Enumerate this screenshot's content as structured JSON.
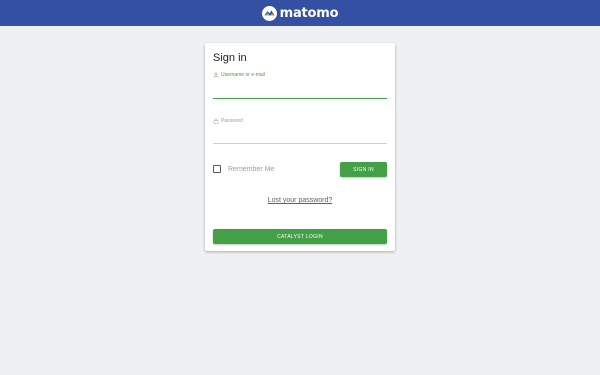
{
  "header": {
    "logo_text": "matomo",
    "logo_icon": "matomo-logo-icon",
    "background_color": "#3450a3"
  },
  "login": {
    "title": "Sign in",
    "username_label": "Username or e-mail",
    "username_value": "",
    "username_icon": "person-icon",
    "password_label": "Password",
    "password_value": "",
    "password_icon": "lock-icon",
    "remember_label": "Remember Me",
    "remember_checked": false,
    "signin_label": "SIGN IN",
    "lost_password_label": "Lost your password?",
    "catalyst_label": "CATALYST LOGIN"
  },
  "colors": {
    "accent": "#43a047",
    "page_background": "#eff0f1"
  }
}
